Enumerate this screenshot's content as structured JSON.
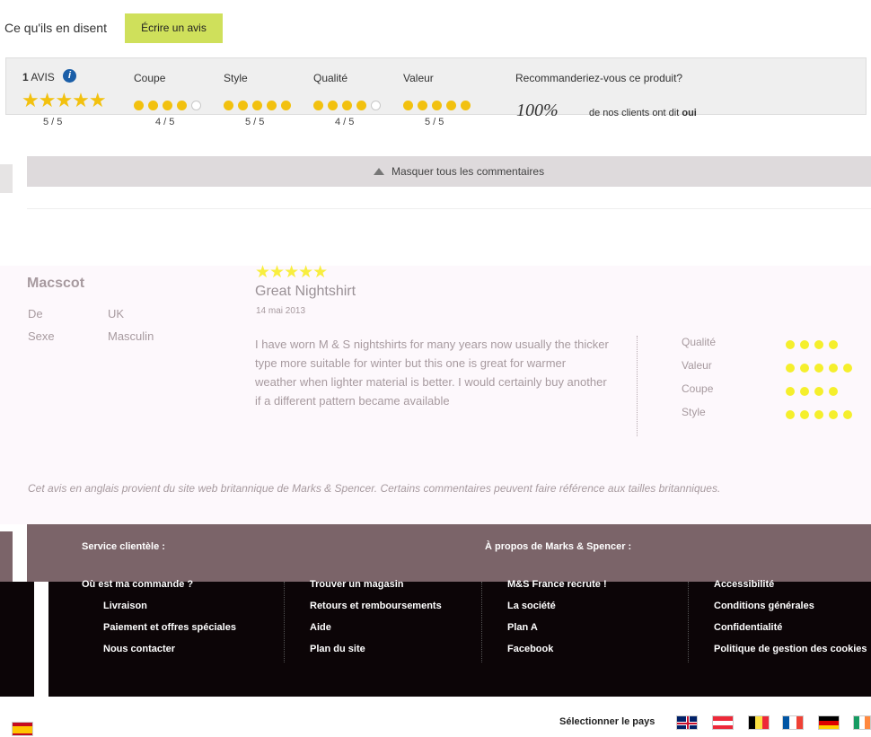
{
  "header": {
    "title": "Ce qu'ils en disent",
    "write_review": "Écrire un avis"
  },
  "summary": {
    "count": "1",
    "count_label": "AVIS",
    "overall": "5 / 5",
    "criteria": [
      {
        "label": "Coupe",
        "rating": 4,
        "max": 5,
        "text": "4 / 5"
      },
      {
        "label": "Style",
        "rating": 5,
        "max": 5,
        "text": "5 / 5"
      },
      {
        "label": "Qualité",
        "rating": 4,
        "max": 5,
        "text": "4 / 5"
      },
      {
        "label": "Valeur",
        "rating": 5,
        "max": 5,
        "text": "5 / 5"
      }
    ],
    "recommend_q": "Recommanderiez-vous ce produit?",
    "recommend_pct": "100%",
    "recommend_text": "de nos clients ont dit",
    "recommend_answer": "oui"
  },
  "toggle": {
    "label": "Masquer tous les commentaires"
  },
  "review": {
    "author": "Macscot",
    "from_label": "De",
    "from_value": "UK",
    "sex_label": "Sexe",
    "sex_value": "Masculin",
    "stars": 5,
    "title": "Great Nightshirt",
    "date": "14 mai 2013",
    "body": "I have worn M & S nightshirts for many years now usually the thicker type more suitable for winter but this one is great for warmer weather when lighter material is better. I would certainly buy another if a different pattern became available",
    "ratings": [
      {
        "label": "Qualité",
        "value": 4
      },
      {
        "label": "Valeur",
        "value": 5
      },
      {
        "label": "Coupe",
        "value": 4
      },
      {
        "label": "Style",
        "value": 5
      }
    ]
  },
  "disclaimer": "Cet avis en anglais provient du site web britannique de Marks & Spencer. Certains commentaires peuvent faire référence aux tailles britanniques.",
  "footer": {
    "service_title": "Service clientèle :",
    "about_title": "À propos de Marks & Spencer :",
    "col1": [
      "Où est ma commande ?",
      "Livraison",
      "Paiement et offres spéciales",
      "Nous contacter"
    ],
    "col2": [
      "Trouver un magasin",
      "Retours et remboursements",
      "Aide",
      "Plan du site"
    ],
    "col3": [
      "M&S France recrute !",
      "La société",
      "Plan A",
      "Facebook"
    ],
    "col4": [
      "Accessibilité",
      "Conditions générales",
      "Confidentialité",
      "Politique de gestion des cookies"
    ]
  },
  "country": {
    "label": "Sélectionner le pays"
  },
  "colors": {
    "accent_button": "#cfe05b",
    "footer_bg": "#7b6469",
    "star": "#f2c10f"
  }
}
